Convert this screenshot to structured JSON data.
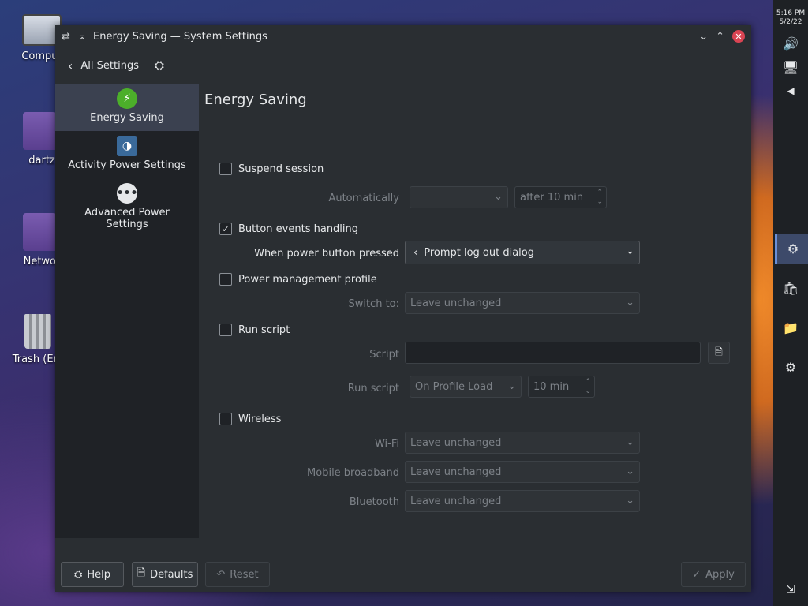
{
  "window": {
    "title": "Energy Saving — System Settings"
  },
  "toolbar": {
    "back_label": "All Settings"
  },
  "desktop": {
    "icons": [
      {
        "label": "Comput"
      },
      {
        "label": "dartz"
      },
      {
        "label": "Networ"
      },
      {
        "label": "Trash (Em"
      }
    ]
  },
  "panel": {
    "time": "5:16 PM",
    "date": "5/2/22"
  },
  "sidebar": {
    "items": [
      {
        "label": "Energy Saving"
      },
      {
        "label": "Activity Power Settings"
      },
      {
        "label": "Advanced Power Settings"
      }
    ]
  },
  "content": {
    "title": "Energy Saving",
    "suspend": {
      "label": "Suspend session",
      "checked": false,
      "auto_label": "Automatically",
      "auto_value": "",
      "after": "after 10 min"
    },
    "buttons": {
      "label": "Button events handling",
      "checked": true,
      "power_label": "When power button pressed",
      "power_value": "Prompt log out dialog"
    },
    "profile": {
      "label": "Power management profile",
      "checked": false,
      "switch_label": "Switch to:",
      "switch_value": "Leave unchanged"
    },
    "script": {
      "label": "Run script",
      "checked": false,
      "script_label": "Script",
      "script_value": "",
      "run_label": "Run script",
      "run_value": "On Profile Load",
      "run_time": "10 min"
    },
    "wireless": {
      "label": "Wireless",
      "checked": false,
      "wifi_label": "Wi-Fi",
      "wifi_value": "Leave unchanged",
      "mobile_label": "Mobile broadband",
      "mobile_value": "Leave unchanged",
      "bt_label": "Bluetooth",
      "bt_value": "Leave unchanged"
    }
  },
  "footer": {
    "help": "Help",
    "defaults": "Defaults",
    "reset": "Reset",
    "apply": "Apply"
  }
}
